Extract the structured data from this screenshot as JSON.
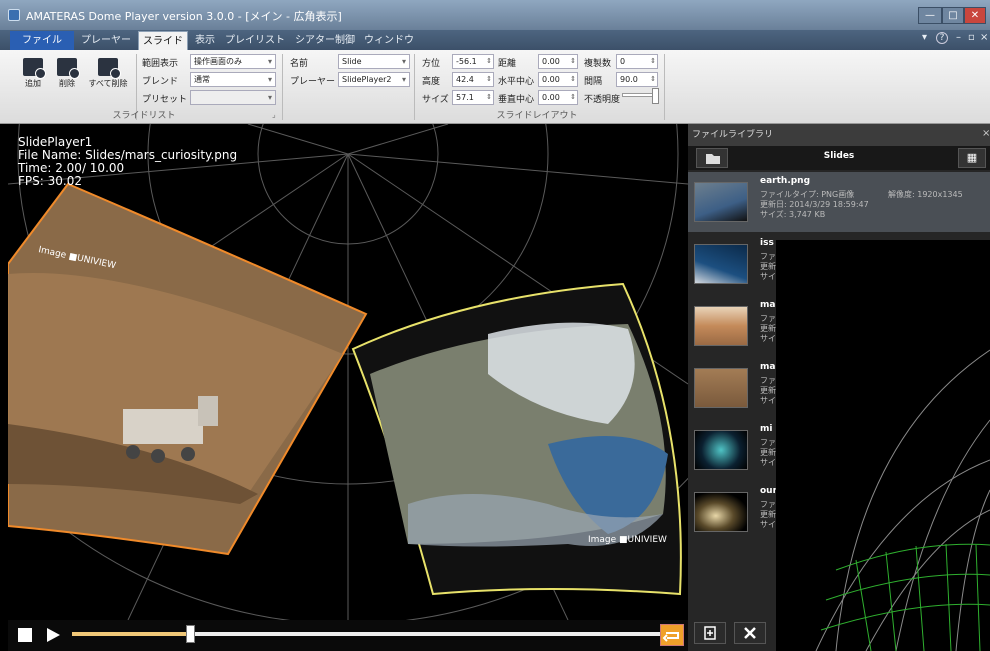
{
  "window": {
    "title": "AMATERAS Dome Player version 3.0.0 - [メイン - 広角表示]",
    "controls": [
      "—",
      "□",
      "✕"
    ]
  },
  "menu": {
    "tabs": [
      "ファイル",
      "プレーヤー",
      "スライド",
      "表示",
      "プレイリスト",
      "シアター制御",
      "ウィンドウ"
    ],
    "active_tab": "スライド",
    "right_controls": [
      "▾",
      "?",
      "–",
      "▫",
      "×"
    ]
  },
  "ribbon": {
    "buttons": {
      "add": "追加",
      "delete": "削除",
      "delete_all": "すべて削除"
    },
    "slide_list": {
      "range_label": "範囲表示",
      "range_value": "操作画面のみ",
      "blend_label": "ブレンド",
      "blend_value": "通常",
      "preset_label": "プリセット",
      "preset_value": "",
      "group_label": "スライドリスト"
    },
    "name_label": "名前",
    "name_value": "Slide",
    "player_label": "プレーヤー",
    "player_value": "SlidePlayer2",
    "layout": {
      "azimuth_label": "方位",
      "azimuth_value": "-56.1",
      "altitude_label": "高度",
      "altitude_value": "42.4",
      "size_label": "サイズ",
      "size_value": "57.1",
      "distance_label": "距離",
      "distance_value": "0.00",
      "hcenter_label": "水平中心",
      "hcenter_value": "0.00",
      "vcenter_label": "垂直中心",
      "vcenter_value": "0.00",
      "copies_label": "複製数",
      "copies_value": "0",
      "interval_label": "間隔",
      "interval_value": "90.0",
      "opacity_label": "不透明度",
      "group_label": "スライドレイアウト"
    }
  },
  "viewport": {
    "player": "SlidePlayer1",
    "file_name": "File Name: Slides/mars_curiosity.png",
    "time": "Time:    2.00/  10.00",
    "fps": "FPS: 30.02",
    "watermark_mars": "Image ■UNIVIEW",
    "watermark_earth": "Image ■UNIVIEW"
  },
  "playback": {
    "progress": 0.2
  },
  "library": {
    "header": "ファイルライブラリ",
    "folder": "Slides",
    "selected": {
      "name": "earth.png",
      "type": "ファイルタイプ: PNG画像",
      "resolution": "解像度: 1920x1345",
      "updated": "更新日: 2014/3/29 18:59:47",
      "size": "サイズ: 3,747 KB"
    },
    "items": [
      {
        "name": "iss",
        "l1": "ファイ",
        "l2": "更新",
        "l3": "サイ"
      },
      {
        "name": "mar",
        "l1": "ファイ",
        "l2": "更新",
        "l3": "サイ"
      },
      {
        "name": "mar",
        "l1": "ファイ",
        "l2": "更新",
        "l3": "サイ"
      },
      {
        "name": "mi",
        "l1": "ファイ",
        "l2": "更新",
        "l3": "サイ"
      },
      {
        "name": "our",
        "l1": "ファイ",
        "l2": "更新",
        "l3": "サイ"
      }
    ]
  }
}
